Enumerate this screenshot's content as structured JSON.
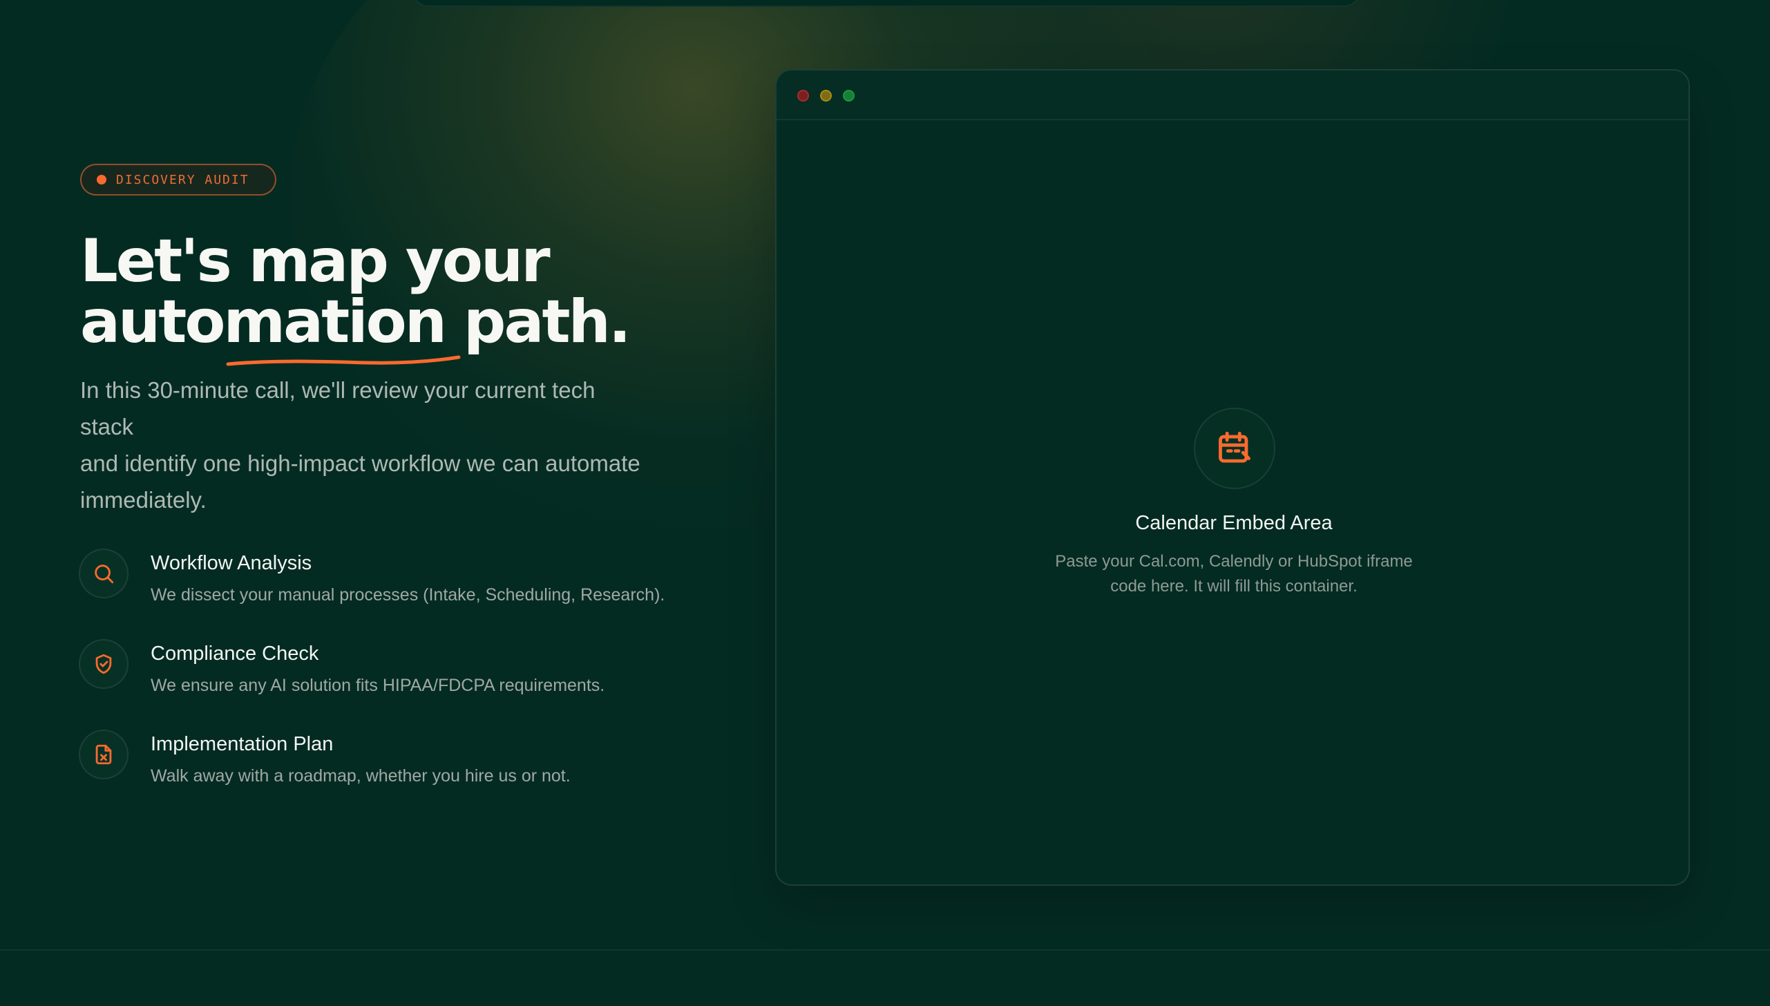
{
  "theme": {
    "background": "#042b22",
    "accent": "#fa6a2e",
    "accent_text": "#f06b35"
  },
  "badge": {
    "label": "DISCOVERY AUDIT"
  },
  "headline": {
    "line1": "Let's map your",
    "line2": "automation path."
  },
  "intro": {
    "line1": "In this 30-minute call, we'll review your current tech",
    "line2": "stack",
    "line3": "and identify one high-impact workflow we can automate",
    "line4": "immediately."
  },
  "features": [
    {
      "icon": "search-icon",
      "title": "Workflow Analysis",
      "description": "We dissect your manual processes (Intake, Scheduling, Research)."
    },
    {
      "icon": "shield-check-icon",
      "title": "Compliance Check",
      "description": "We ensure any AI solution fits HIPAA/FDCPA requirements."
    },
    {
      "icon": "file-x-icon",
      "title": "Implementation Plan",
      "description": "Walk away with a roadmap, whether you hire us or not."
    }
  ],
  "embed": {
    "window_controls": [
      "close",
      "minimize",
      "maximize"
    ],
    "icon": "calendar-clock-icon",
    "title": "Calendar Embed Area",
    "description_line1": "Paste your Cal.com, Calendly or HubSpot iframe",
    "description_line2": "code here. It will fill this container."
  }
}
